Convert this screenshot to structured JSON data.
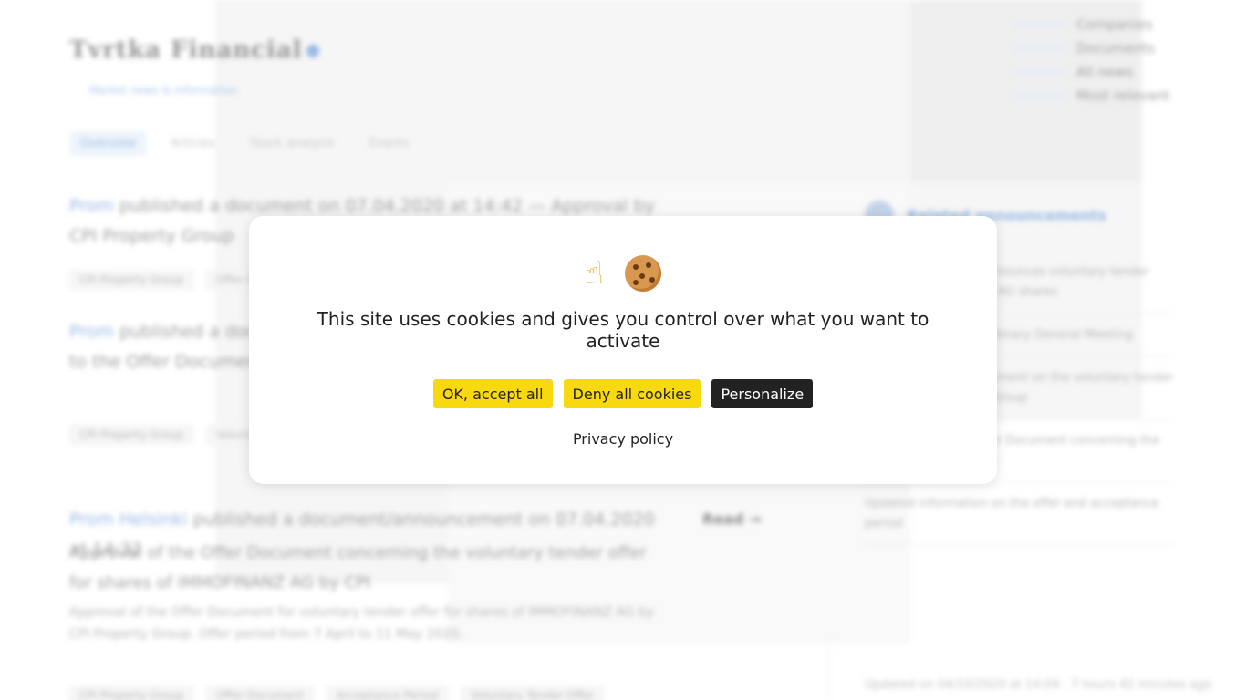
{
  "background": {
    "logo_text": "Tvrtka Financial",
    "logo_subtitle": "Market news & information",
    "top_links": [
      "Companies",
      "Documents",
      "All news",
      "Most relevant"
    ],
    "nav_tabs": [
      "Overview",
      "Articles",
      "Stock analysis",
      "Events"
    ],
    "articles": [
      {
        "source": "Prom",
        "title_rest": "published a document on 07.04.2020 at 14:42 — Approval by CPI Property Group",
        "tags": [
          "CPI Property Group",
          "Offer Document"
        ]
      },
      {
        "source": "Prom",
        "title_rest": "published a document on 07.04.2020 at 14:32 — Supplement to the Offer Document",
        "tags": [
          "CPI Property Group",
          "Voluntary Tender Offer"
        ]
      },
      {
        "source": "Prom Helsinki",
        "title_rest": "published a document/announcement on 07.04.2020 at 14:32",
        "meta": "Read →",
        "title_line2": "Approval of the Offer Document concerning the voluntary tender offer for shares of IMMOFINANZ AG by CPI",
        "desc": "Approval of the Offer Document for voluntary tender offer for shares of IMMOFINANZ AG by CPI Property Group. Offer period from 7 April to 11 May 2020.",
        "tags": [
          "CPI Property Group",
          "Offer Document",
          "Acceptance Period",
          "Voluntary Tender Offer"
        ]
      }
    ],
    "sidebar": {
      "title": "Related announcements",
      "items": [
        "CPI Property Group announces voluntary tender offer for IMMOFINANZ AG shares",
        "Results of the Extraordinary General Meeting",
        "IMMOFINANZ AG statement on the voluntary tender offer by CPI Property Group",
        "Publication of the Offer Document concerning the voluntary tender offer",
        "Updated information on the offer and acceptance period"
      ],
      "updated": "Updated on 04/10/2020 at 14:04 · 7 hours 42 minutes ago"
    }
  },
  "cookie_modal": {
    "message": "This site uses cookies and gives you control over what you want to activate",
    "accept_label": "OK, accept all",
    "deny_label": "Deny all cookies",
    "personalize_label": "Personalize",
    "privacy_label": "Privacy policy",
    "icons": [
      "pointing-finger-icon",
      "cookie-icon"
    ],
    "colors": {
      "accept": "#f8d90f",
      "deny": "#f8d90f",
      "personalize": "#222222"
    }
  }
}
